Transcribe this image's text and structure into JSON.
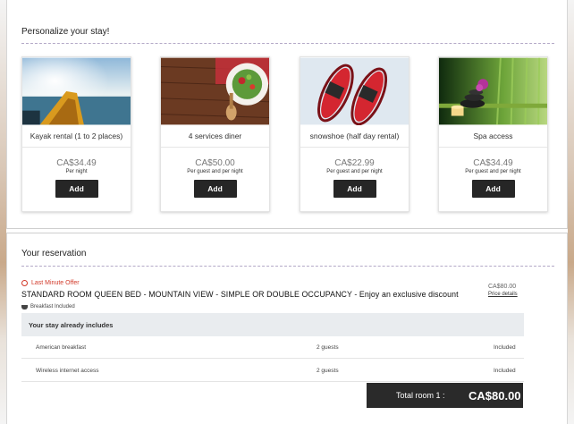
{
  "personalize": {
    "title": "Personalize your stay!",
    "items": [
      {
        "name": "Kayak rental (1 to 2 places)",
        "price": "CA$34.49",
        "per": "Per night",
        "button": "Add",
        "icon": "kayak-photo"
      },
      {
        "name": "4 services diner",
        "price": "CA$50.00",
        "per": "Per guest and per night",
        "button": "Add",
        "icon": "dinner-photo"
      },
      {
        "name": "snowshoe (half day rental)",
        "price": "CA$22.99",
        "per": "Per guest and per night",
        "button": "Add",
        "icon": "snowshoe-photo"
      },
      {
        "name": "Spa access",
        "price": "CA$34.49",
        "per": "Per guest and per night",
        "button": "Add",
        "icon": "spa-photo"
      }
    ]
  },
  "reservation": {
    "title": "Your reservation",
    "offer": "Last Minute Offer",
    "room": "STANDARD ROOM QUEEN BED - MOUNTAIN VIEW - SIMPLE OR DOUBLE OCCUPANCY - Enjoy an exclusive discount",
    "price": "CA$80.00",
    "price_details": "Price details",
    "breakfast": "Breakfast Included",
    "includes_title": "Your stay already includes",
    "includes": [
      {
        "item": "American breakfast",
        "guests": "2 guests",
        "status": "Included"
      },
      {
        "item": "Wireless internet access",
        "guests": "2 guests",
        "status": "Included"
      }
    ],
    "total_label": "Total room 1 :",
    "total_value": "CA$80.00"
  },
  "colors": {
    "accent_dark": "#262626",
    "offer_red": "#d23a2a",
    "dash": "#b3a9c7"
  }
}
